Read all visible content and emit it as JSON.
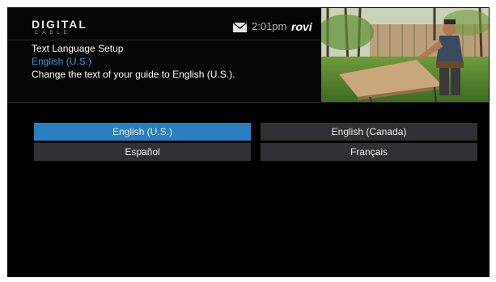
{
  "header": {
    "logo_main": "DIGITAL",
    "logo_sub": "CABLE",
    "time": "2:01pm",
    "brand": "rovi",
    "icons": {
      "mail": "mail-icon"
    }
  },
  "setup": {
    "title": "Text Language Setup",
    "selected": "English (U.S.)",
    "description": "Change the text of your guide to English (U.S.)."
  },
  "options": [
    {
      "label": "English (U.S.)",
      "selected": true
    },
    {
      "label": "English (Canada)",
      "selected": false
    },
    {
      "label": "Español",
      "selected": false
    },
    {
      "label": "Français",
      "selected": false
    }
  ],
  "colors": {
    "accent_text": "#3a9ad9",
    "selected_bg": "#2a7fc1",
    "option_bg": "#2f3136"
  }
}
